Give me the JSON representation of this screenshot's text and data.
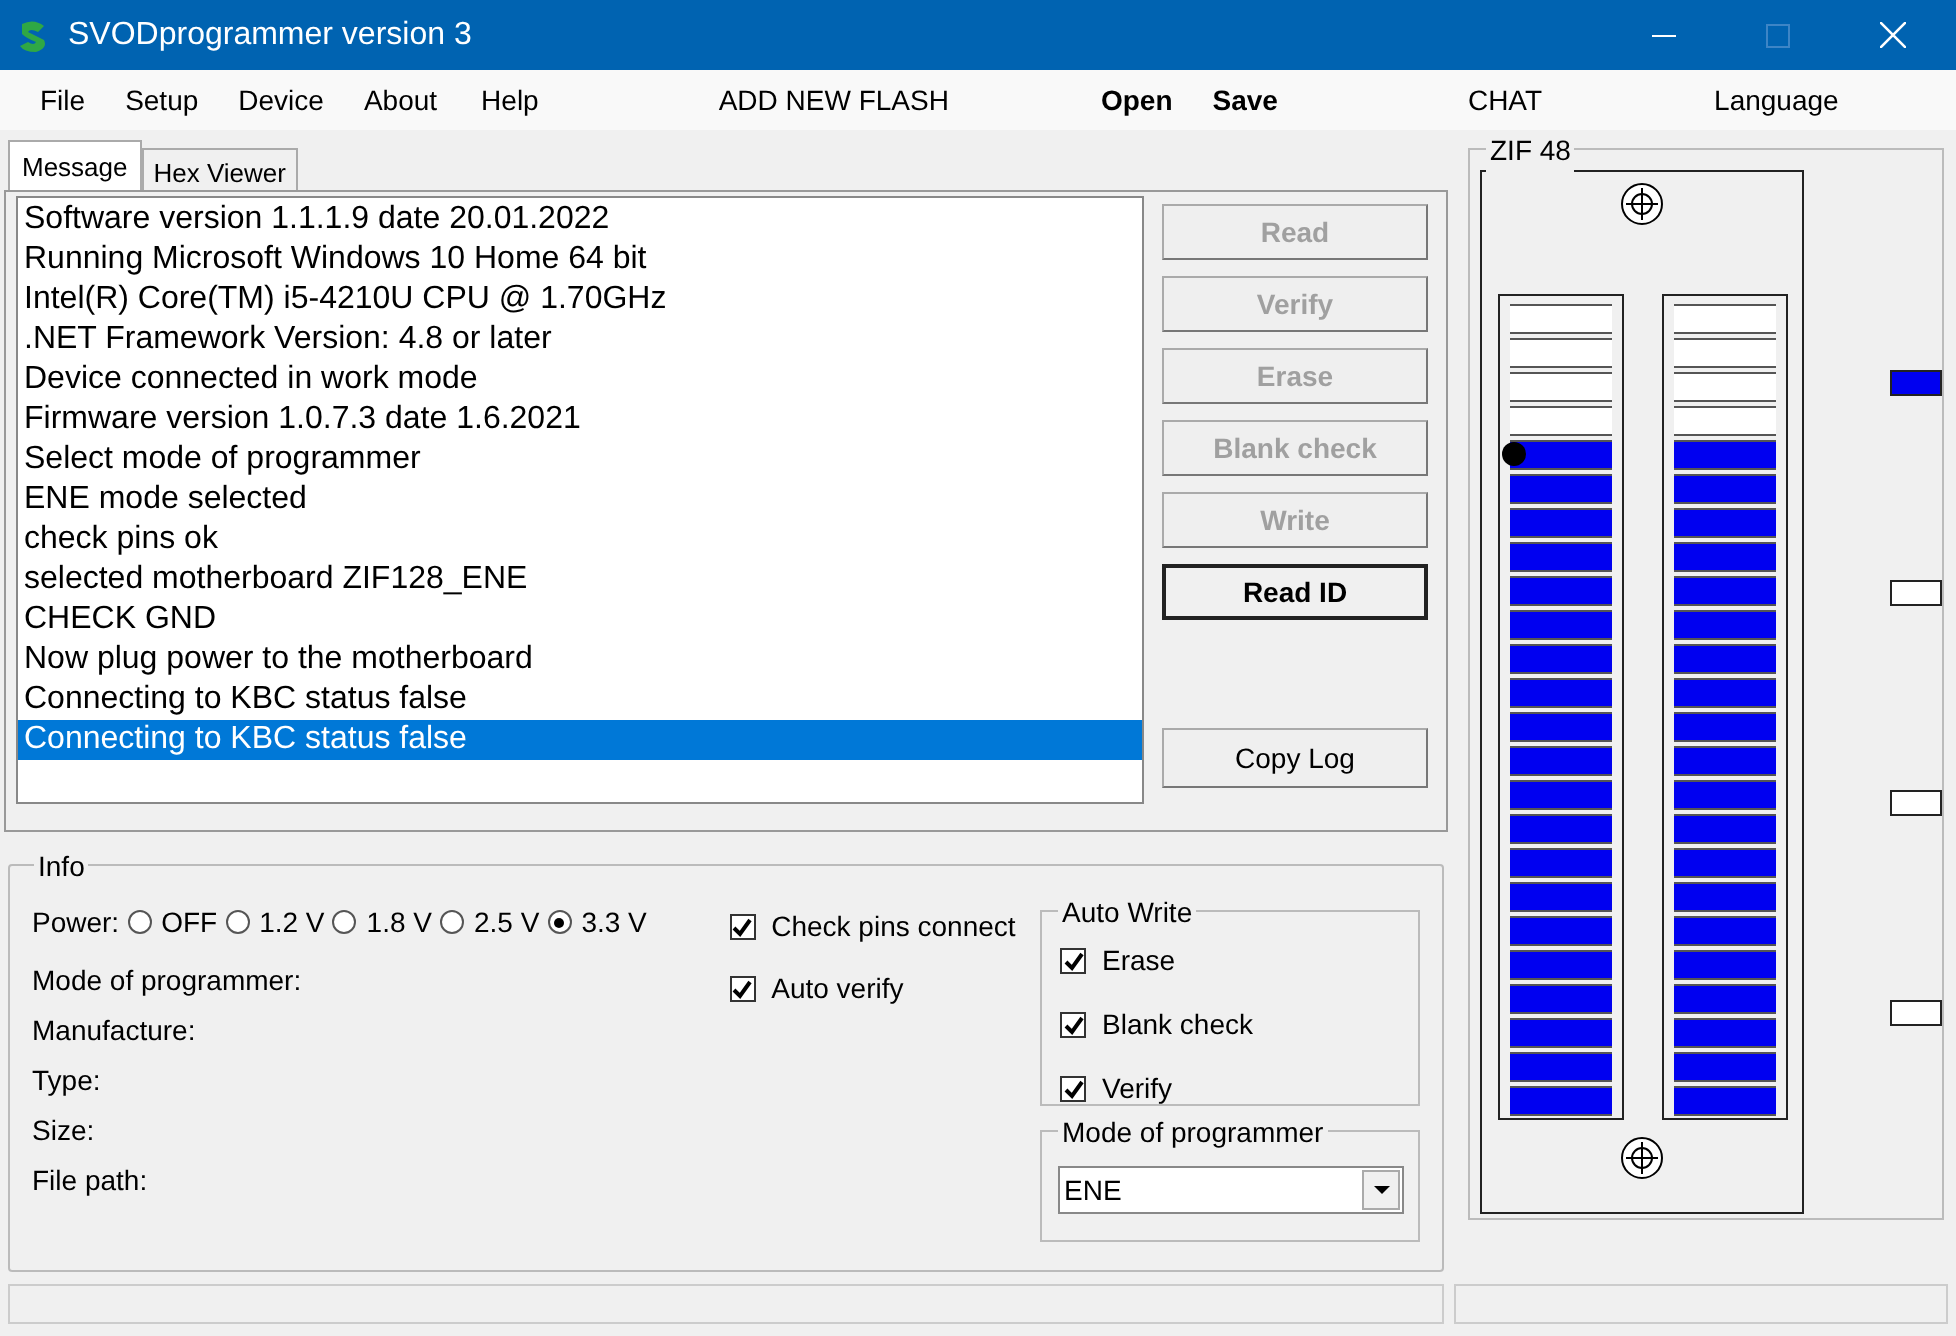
{
  "window": {
    "title": "SVODprogrammer version 3"
  },
  "menu": [
    {
      "label": "File",
      "bold": false
    },
    {
      "label": "Setup",
      "bold": false
    },
    {
      "label": "Device",
      "bold": false
    },
    {
      "label": "About",
      "bold": false
    },
    {
      "label": "Help",
      "bold": false
    },
    {
      "label": "ADD NEW FLASH",
      "bold": false
    },
    {
      "label": "Open",
      "bold": true
    },
    {
      "label": "Save",
      "bold": true
    },
    {
      "label": "CHAT",
      "bold": false
    },
    {
      "label": "Language",
      "bold": false
    }
  ],
  "tabs": [
    {
      "label": "Message",
      "selected": true
    },
    {
      "label": "Hex Viewer",
      "selected": false
    }
  ],
  "log": [
    {
      "text": "Software version 1.1.1.9 date 20.01.2022",
      "selected": false
    },
    {
      "text": "Running Microsoft Windows 10 Home 64 bit",
      "selected": false
    },
    {
      "text": "Intel(R) Core(TM) i5-4210U CPU @ 1.70GHz",
      "selected": false
    },
    {
      "text": ".NET Framework Version: 4.8 or later",
      "selected": false
    },
    {
      "text": "Device connected in work mode",
      "selected": false
    },
    {
      "text": "Firmware version 1.0.7.3 date 1.6.2021",
      "selected": false
    },
    {
      "text": "Select mode of programmer",
      "selected": false
    },
    {
      "text": "ENE mode selected",
      "selected": false
    },
    {
      "text": "check pins ok",
      "selected": false
    },
    {
      "text": "selected motherboard ZIF128_ENE",
      "selected": false
    },
    {
      "text": "CHECK GND",
      "selected": false
    },
    {
      "text": "Now plug power to the motherboard",
      "selected": false
    },
    {
      "text": "Connecting to KBC status false",
      "selected": false
    },
    {
      "text": "Connecting to KBC status false",
      "selected": true
    }
  ],
  "actions": [
    {
      "label": "Read",
      "disabled": true,
      "default": false
    },
    {
      "label": "Verify",
      "disabled": true,
      "default": false
    },
    {
      "label": "Erase",
      "disabled": true,
      "default": false
    },
    {
      "label": "Blank check",
      "disabled": true,
      "default": false
    },
    {
      "label": "Write",
      "disabled": true,
      "default": false
    },
    {
      "label": "Read ID",
      "disabled": false,
      "default": true
    }
  ],
  "copy_log": {
    "label": "Copy Log"
  },
  "info": {
    "title": "Info",
    "power_label": "Power:",
    "power_options": [
      {
        "label": "OFF",
        "selected": false
      },
      {
        "label": "1.2 V",
        "selected": false
      },
      {
        "label": "1.8 V",
        "selected": false
      },
      {
        "label": "2.5 V",
        "selected": false
      },
      {
        "label": "3.3 V",
        "selected": true
      }
    ],
    "checks": [
      {
        "label": "Check pins connect",
        "checked": true
      },
      {
        "label": "Auto verify",
        "checked": true
      }
    ],
    "fields": [
      "Mode of programmer:",
      "Manufacture:",
      "Type:",
      "Size:",
      "File path:"
    ],
    "auto_write": {
      "title": "Auto Write",
      "options": [
        {
          "label": "Erase",
          "checked": true
        },
        {
          "label": "Blank check",
          "checked": true
        },
        {
          "label": "Verify",
          "checked": true
        }
      ]
    },
    "mode": {
      "title": "Mode of programmer",
      "value": "ENE"
    }
  },
  "zif": {
    "title": "ZIF 48",
    "left_pins": [
      {
        "on": false
      },
      {
        "on": false
      },
      {
        "on": false
      },
      {
        "on": false
      },
      {
        "on": true
      },
      {
        "on": true
      },
      {
        "on": true
      },
      {
        "on": true
      },
      {
        "on": true
      },
      {
        "on": true
      },
      {
        "on": true
      },
      {
        "on": true
      },
      {
        "on": true
      },
      {
        "on": true
      },
      {
        "on": true
      },
      {
        "on": true
      },
      {
        "on": true
      },
      {
        "on": true
      },
      {
        "on": true
      },
      {
        "on": true
      },
      {
        "on": true
      },
      {
        "on": true
      },
      {
        "on": true
      },
      {
        "on": true
      }
    ],
    "right_pins": [
      {
        "on": false
      },
      {
        "on": false
      },
      {
        "on": false
      },
      {
        "on": false
      },
      {
        "on": true
      },
      {
        "on": true
      },
      {
        "on": true
      },
      {
        "on": true
      },
      {
        "on": true
      },
      {
        "on": true
      },
      {
        "on": true
      },
      {
        "on": true
      },
      {
        "on": true
      },
      {
        "on": true
      },
      {
        "on": true
      },
      {
        "on": true
      },
      {
        "on": true
      },
      {
        "on": true
      },
      {
        "on": true
      },
      {
        "on": true
      },
      {
        "on": true
      },
      {
        "on": true
      },
      {
        "on": true
      },
      {
        "on": true
      }
    ],
    "indicators": [
      {
        "on": true
      },
      {
        "on": false
      },
      {
        "on": false
      },
      {
        "on": false
      }
    ]
  }
}
